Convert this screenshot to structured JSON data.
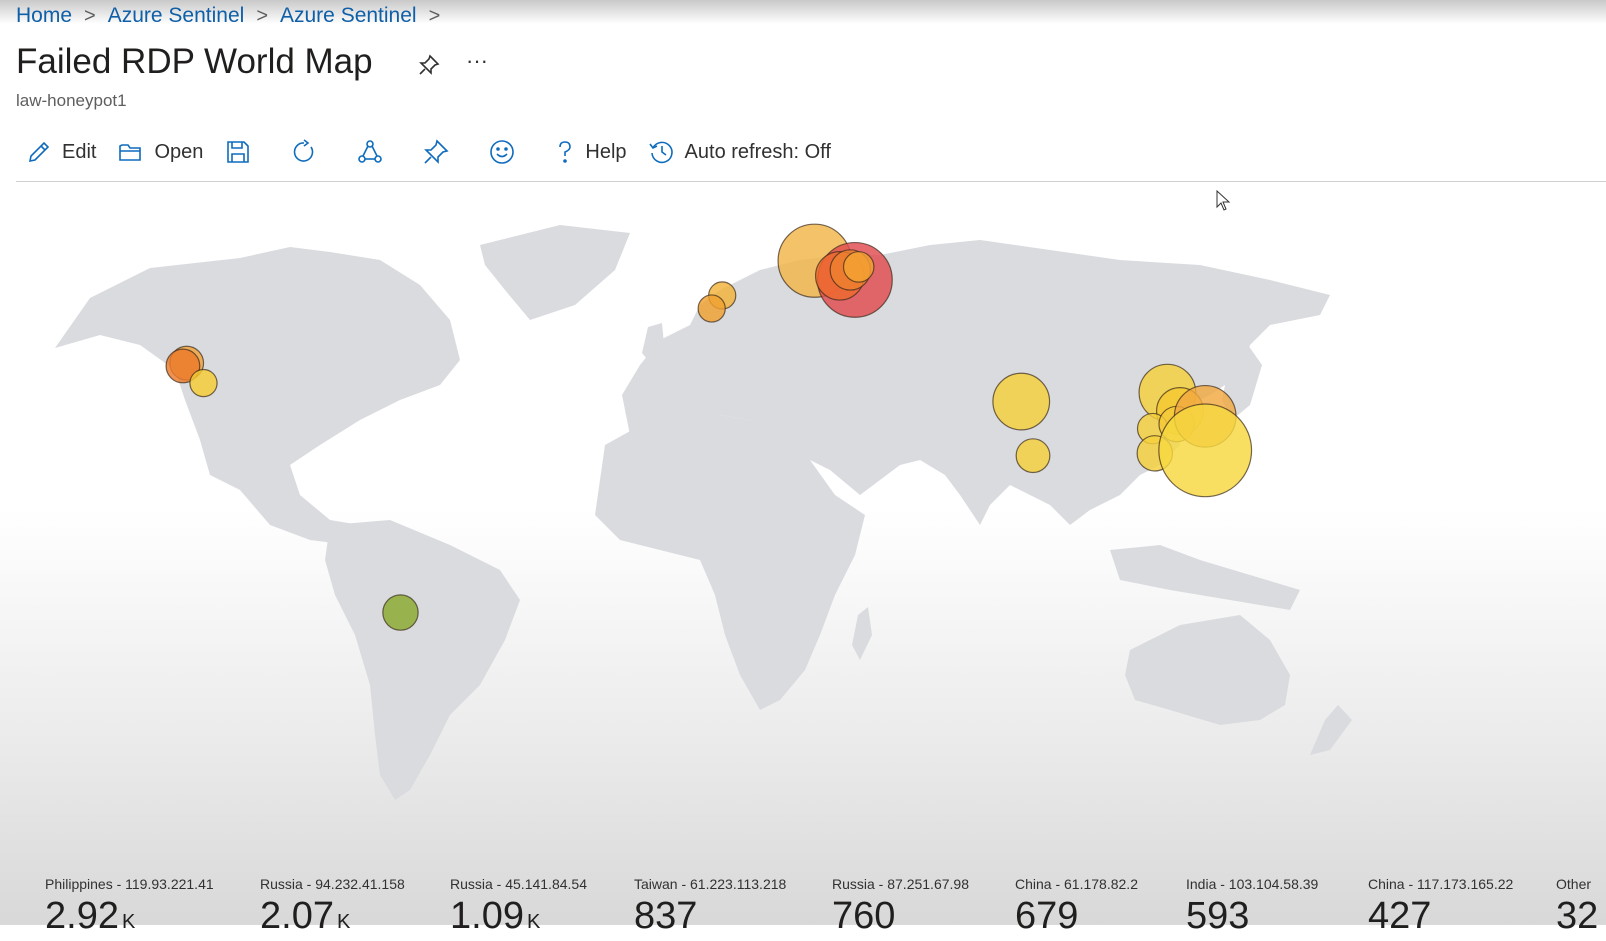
{
  "breadcrumb": {
    "items": [
      "Home",
      "Azure Sentinel",
      "Azure Sentinel"
    ]
  },
  "page": {
    "title": "Failed RDP World Map",
    "subtitle": "law-honeypot1",
    "more_label": "···"
  },
  "toolbar": {
    "edit_label": "Edit",
    "open_label": "Open",
    "help_label": "Help",
    "auto_refresh_label": "Auto refresh: Off"
  },
  "map": {
    "land_color": "#d9dbdf",
    "bubbles": [
      {
        "lat": 38.5,
        "lon": -121.5,
        "size": 0.12,
        "color": "#f2a23a"
      },
      {
        "lat": 37.8,
        "lon": -122.4,
        "size": 0.12,
        "color": "#ec7a2a"
      },
      {
        "lat": 33.5,
        "lon": -117.5,
        "size": 0.08,
        "color": "#f7cc33"
      },
      {
        "lat": 53.0,
        "lon": 6.0,
        "size": 0.08,
        "color": "#f3b23a"
      },
      {
        "lat": 50.5,
        "lon": 3.5,
        "size": 0.08,
        "color": "#f0a030"
      },
      {
        "lat": 59.0,
        "lon": 28.0,
        "size": 0.36,
        "color": "#f2b548"
      },
      {
        "lat": 55.8,
        "lon": 37.6,
        "size": 0.37,
        "color": "#e14a4e"
      },
      {
        "lat": 56.5,
        "lon": 34.0,
        "size": 0.21,
        "color": "#ee6a2e"
      },
      {
        "lat": 57.5,
        "lon": 36.5,
        "size": 0.16,
        "color": "#ed8030"
      },
      {
        "lat": 58.0,
        "lon": 38.5,
        "size": 0.1,
        "color": "#f4a332"
      },
      {
        "lat": 28.6,
        "lon": 77.2,
        "size": 0.26,
        "color": "#f5cf3c"
      },
      {
        "lat": 13.0,
        "lon": 80.0,
        "size": 0.12,
        "color": "#f5cf3c"
      },
      {
        "lat": 31.0,
        "lon": 112.0,
        "size": 0.26,
        "color": "#f5cf3c"
      },
      {
        "lat": 26.0,
        "lon": 115.0,
        "size": 0.2,
        "color": "#f5c832"
      },
      {
        "lat": 21.0,
        "lon": 108.5,
        "size": 0.1,
        "color": "#f5cf3c"
      },
      {
        "lat": 13.7,
        "lon": 109.0,
        "size": 0.13,
        "color": "#f5cf3c"
      },
      {
        "lat": 22.3,
        "lon": 114.2,
        "size": 0.13,
        "color": "#f5c93a"
      },
      {
        "lat": 24.5,
        "lon": 121.0,
        "size": 0.29,
        "color": "#f2a841"
      },
      {
        "lat": 14.6,
        "lon": 121.0,
        "size": 0.48,
        "color": "#f7d840"
      },
      {
        "lat": -33.4,
        "lon": -70.6,
        "size": 0.13,
        "color": "#8aaa2e"
      }
    ]
  },
  "tiles": [
    {
      "label": "Philippines - 119.93.221.41",
      "value": "2.92",
      "unit": "K"
    },
    {
      "label": "Russia - 94.232.41.158",
      "value": "2.07",
      "unit": "K"
    },
    {
      "label": "Russia - 45.141.84.54",
      "value": "1.09",
      "unit": "K"
    },
    {
      "label": "Taiwan - 61.223.113.218",
      "value": "837",
      "unit": ""
    },
    {
      "label": "Russia - 87.251.67.98",
      "value": "760",
      "unit": ""
    },
    {
      "label": "China - 61.178.82.2",
      "value": "679",
      "unit": ""
    },
    {
      "label": "India - 103.104.58.39",
      "value": "593",
      "unit": ""
    },
    {
      "label": "China - 117.173.165.22",
      "value": "427",
      "unit": ""
    },
    {
      "label": "Other",
      "value": "32",
      "unit": ""
    }
  ]
}
